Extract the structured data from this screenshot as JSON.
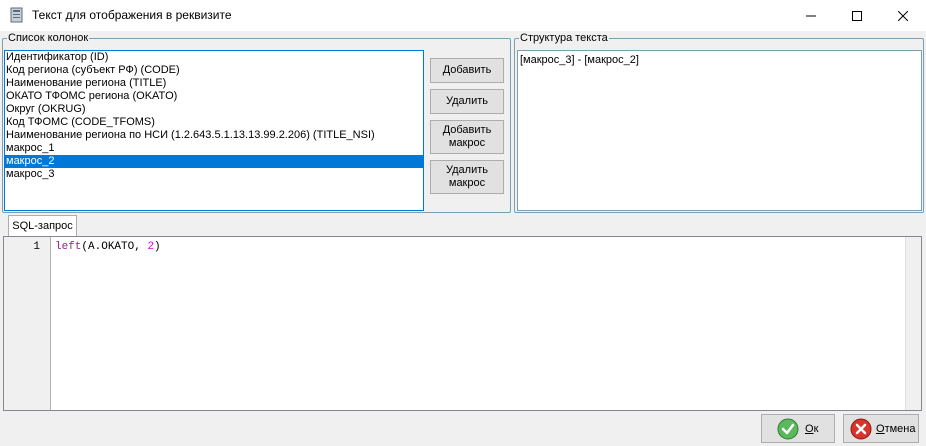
{
  "window": {
    "title": "Текст для отображения в реквизите"
  },
  "columns_group": {
    "legend": "Список колонок",
    "items": [
      {
        "label": "Идентификатор (ID)",
        "selected": false
      },
      {
        "label": "Код региона (субъект РФ) (CODE)",
        "selected": false
      },
      {
        "label": "Наименование региона (TITLE)",
        "selected": false
      },
      {
        "label": "ОКАТО ТФОМС региона (OKATO)",
        "selected": false
      },
      {
        "label": "Округ (OKRUG)",
        "selected": false
      },
      {
        "label": "Код ТФОМС (CODE_TFOMS)",
        "selected": false
      },
      {
        "label": "Наименование региона по НСИ (1.2.643.5.1.13.13.99.2.206) (TITLE_NSI)",
        "selected": false
      },
      {
        "label": "макрос_1",
        "selected": false
      },
      {
        "label": "макрос_2",
        "selected": true
      },
      {
        "label": "макрос_3",
        "selected": false
      }
    ],
    "buttons": {
      "add": "Добавить",
      "remove": "Удалить",
      "add_macro": "Добавить макрос",
      "remove_macro": "Удалить макрос"
    }
  },
  "structure_group": {
    "legend": "Структура текста",
    "text": "[макрос_3] - [макрос_2]"
  },
  "sql_tab": {
    "label": "SQL-запрос",
    "line_number": "1",
    "code": {
      "func": "left",
      "open": "(",
      "arg": "A.OKATO, ",
      "num": "2",
      "close": ")"
    }
  },
  "footer": {
    "ok": "Ок",
    "cancel": "Отмена"
  }
}
